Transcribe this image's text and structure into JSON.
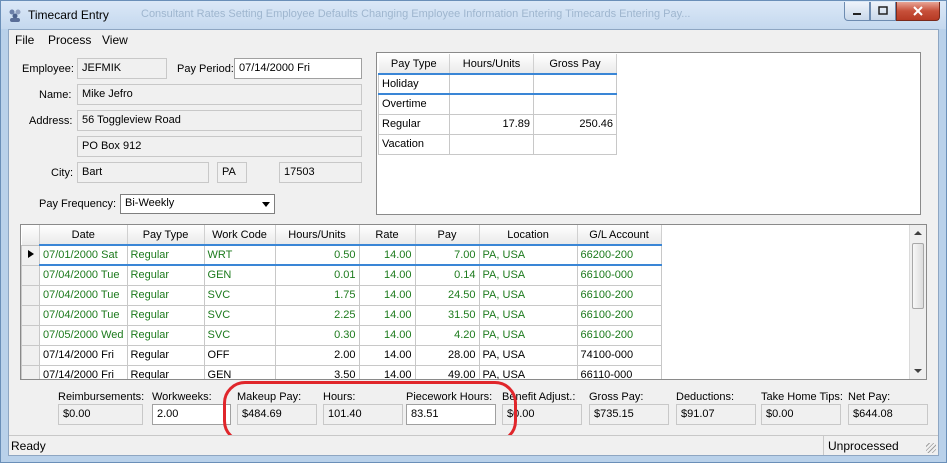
{
  "window": {
    "title": "Timecard Entry",
    "ghost_tabs": "Consultant Rates    Setting Employee Defaults    Changing Employee Information    Entering Timecards    Entering Pay..."
  },
  "menu": [
    "File",
    "Process",
    "View"
  ],
  "employee": {
    "employee_label": "Employee:",
    "employee_id": "JEFMIK",
    "pay_period_label": "Pay Period:",
    "pay_period": "07/14/2000 Fri",
    "name_label": "Name:",
    "name": "Mike Jefro",
    "address_label": "Address:",
    "address1": "56 Toggleview Road",
    "address2": "PO Box 912",
    "city_label": "City:",
    "city": "Bart",
    "state": "PA",
    "zip": "17503",
    "pay_frequency_label": "Pay Frequency:",
    "pay_frequency": "Bi-Weekly"
  },
  "pay_type_grid": {
    "headers": [
      "Pay Type",
      "Hours/Units",
      "Gross Pay"
    ],
    "rows": [
      [
        "Holiday",
        "",
        ""
      ],
      [
        "Overtime",
        "",
        ""
      ],
      [
        "Regular",
        "17.89",
        "250.46"
      ],
      [
        "Vacation",
        "",
        ""
      ]
    ]
  },
  "timecard_grid": {
    "headers": [
      "Date",
      "Pay Type",
      "Work Code",
      "Hours/Units",
      "Rate",
      "Pay",
      "Location",
      "G/L Account"
    ],
    "rows": [
      [
        "07/01/2000 Sat",
        "Regular",
        "WRT",
        "0.50",
        "14.00",
        "7.00",
        "PA, USA",
        "66200-200"
      ],
      [
        "07/04/2000 Tue",
        "Regular",
        "GEN",
        "0.01",
        "14.00",
        "0.14",
        "PA, USA",
        "66100-000"
      ],
      [
        "07/04/2000 Tue",
        "Regular",
        "SVC",
        "1.75",
        "14.00",
        "24.50",
        "PA, USA",
        "66100-200"
      ],
      [
        "07/04/2000 Tue",
        "Regular",
        "SVC",
        "2.25",
        "14.00",
        "31.50",
        "PA, USA",
        "66100-200"
      ],
      [
        "07/05/2000 Wed",
        "Regular",
        "SVC",
        "0.30",
        "14.00",
        "4.20",
        "PA, USA",
        "66100-200"
      ],
      [
        "07/14/2000 Fri",
        "Regular",
        "OFF",
        "2.00",
        "14.00",
        "28.00",
        "PA, USA",
        "74100-000"
      ],
      [
        "07/14/2000 Fri",
        "Regular",
        "GEN",
        "3.50",
        "14.00",
        "49.00",
        "PA, USA",
        "66110-000"
      ]
    ]
  },
  "totals": {
    "reimbursements_label": "Reimbursements:",
    "reimbursements": "$0.00",
    "workweeks_label": "Workweeks:",
    "workweeks": "2.00",
    "makeup_pay_label": "Makeup Pay:",
    "makeup_pay": "$484.69",
    "hours_label": "Hours:",
    "hours": "101.40",
    "piecework_hours_label": "Piecework Hours:",
    "piecework_hours": "83.51",
    "benefit_adjust_label": "Benefit Adjust.:",
    "benefit_adjust": "$0.00",
    "gross_pay_label": "Gross Pay:",
    "gross_pay": "$735.15",
    "deductions_label": "Deductions:",
    "deductions": "$91.07",
    "take_home_tips_label": "Take Home Tips:",
    "take_home_tips": "$0.00",
    "net_pay_label": "Net Pay:",
    "net_pay": "$644.08"
  },
  "status": {
    "left": "Ready",
    "right": "Unprocessed"
  },
  "colors": {
    "highlight_circle": "#e0262b",
    "grid_green_text": "#1c7a1c",
    "selection_border": "#3a86d6"
  }
}
